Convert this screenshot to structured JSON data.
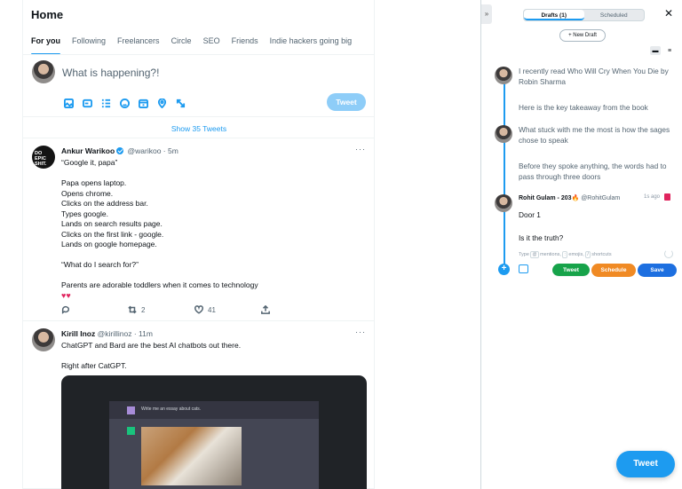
{
  "feed": {
    "title": "Home",
    "tabs": [
      "For you",
      "Following",
      "Freelancers",
      "Circle",
      "SEO",
      "Friends",
      "Indie hackers going big"
    ],
    "compose_placeholder": "What is happening?!",
    "compose_button": "Tweet",
    "show_more": "Show 35 Tweets"
  },
  "tweets": [
    {
      "avatar_text": "DO EPIC SHIT.",
      "name": "Ankur Warikoo",
      "handle": "@warikoo · 5m",
      "more": "···",
      "lines": [
        "“Google it, papa”",
        "",
        "Papa opens laptop.",
        "Opens chrome.",
        "Clicks on the address bar.",
        "Types google.",
        "Lands on search results page.",
        "Clicks on the first link - google.",
        "Lands on google homepage.",
        "",
        "“What do I search for?”",
        "",
        "Parents are adorable toddlers when it comes to technology"
      ],
      "hearts": "♥♥",
      "retweets": "2",
      "likes": "41"
    },
    {
      "name": "Kirill Inoz",
      "handle": "@kirillinoz · 11m",
      "more": "···",
      "lines": [
        "ChatGPT and Bard are the best AI chatbots out there.",
        "",
        "Right after CatGPT."
      ],
      "image_prompt": "Write me an essay about cats."
    }
  ],
  "panel": {
    "collapse_icon": "»",
    "tabs": {
      "drafts": "Drafts (1)",
      "scheduled": "Scheduled"
    },
    "close": "✕",
    "new_draft": "+ New Draft",
    "thread": [
      "I recently read Who Will Cry When You Die by Robin Sharma",
      "Here is the key takeaway from the book",
      "What stuck with me the most is how the sages chose to speak",
      "Before they spoke anything, the words had to pass through three doors"
    ],
    "current": {
      "name": "Rohit Gulam - 203🔥",
      "handle": "@RohitGulam",
      "time": "1s ago",
      "line1": "Door 1",
      "line2": "Is it the truth?"
    },
    "hint": {
      "type": "Type",
      "k1": "@",
      "mentions": "mentions,",
      "k2": ":",
      "emojis": "emojis,",
      "k3": "/",
      "shortcuts": "shortcuts"
    },
    "buttons": {
      "tweet": "Tweet",
      "schedule": "Schedule",
      "save": "Save"
    }
  },
  "floating_tweet": "Tweet",
  "colors": {
    "accent": "#1d9bf0",
    "green": "#17a34a",
    "orange": "#f08a24",
    "blue": "#1d6fe0"
  }
}
